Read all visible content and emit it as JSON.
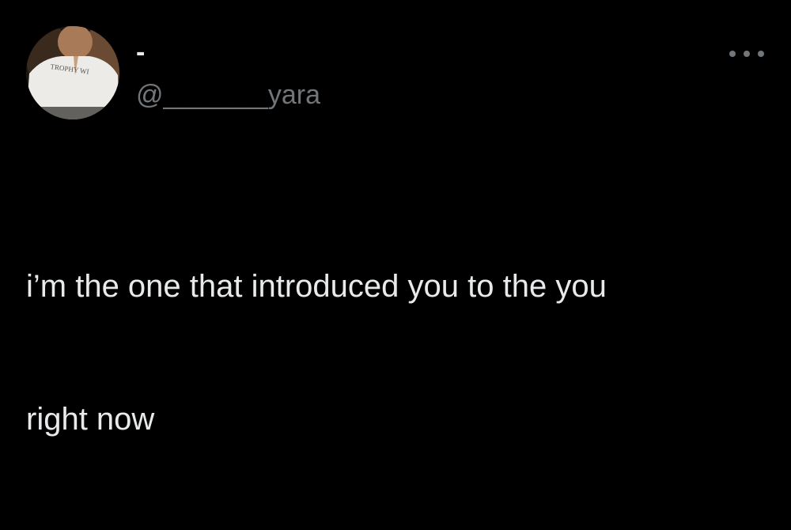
{
  "tweet": {
    "author": {
      "display_name": "-",
      "handle": "@_______yara",
      "avatar_icon": "profile-photo",
      "avatar_shirt_text": "TROPHY WI"
    },
    "more_icon": "ellipsis-icon",
    "text_lines": [
      "i’m the one that introduced you to the you",
      "right now"
    ]
  },
  "colors": {
    "background": "#000000",
    "primary_text": "#e7e9ea",
    "secondary_text": "#71767b"
  }
}
